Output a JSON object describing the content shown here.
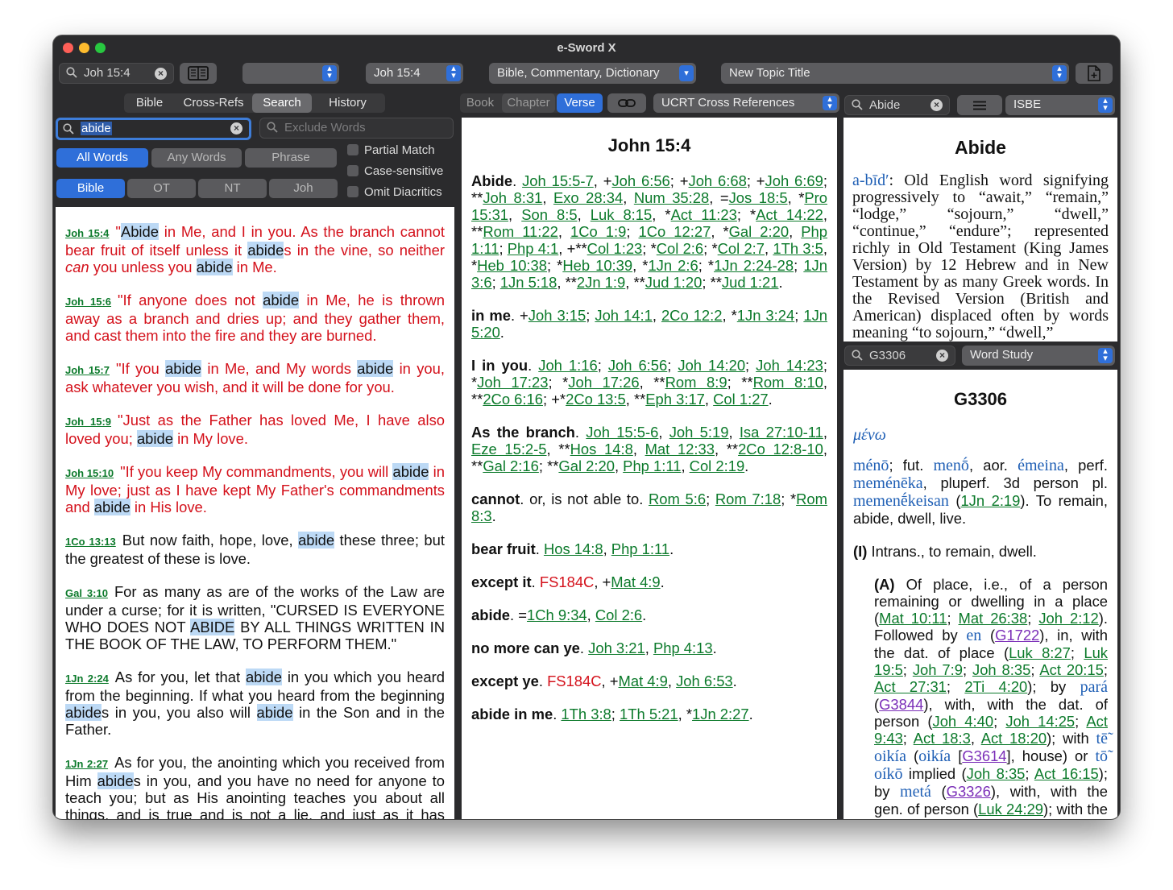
{
  "window": {
    "title": "e-Sword X"
  },
  "toolbar": {
    "nav_search": {
      "value": "Joh 15:4"
    },
    "verse_popup": "Joh 15:4",
    "layout_popup": "Bible, Commentary, Dictionary",
    "topic_popup": "New Topic Title"
  },
  "left": {
    "tabs": [
      "Bible",
      "Cross-Refs",
      "Search",
      "History"
    ],
    "search": {
      "value": "abide",
      "exclude_placeholder": "Exclude Words"
    },
    "modes": [
      "All Words",
      "Any Words",
      "Phrase"
    ],
    "scopes": [
      "Bible",
      "OT",
      "NT",
      "Joh"
    ],
    "options": [
      "Partial Match",
      "Case-sensitive",
      "Omit Diacritics"
    ]
  },
  "results": [
    {
      "ref": "Joh 15:4"
    },
    {
      "ref": "Joh 15:6"
    },
    {
      "ref": "Joh 15:7"
    },
    {
      "ref": "Joh 15:9"
    },
    {
      "ref": "Joh 15:10"
    },
    {
      "ref": "1Co 13:13"
    },
    {
      "ref": "Gal 3:10"
    },
    {
      "ref": "1Jn 2:24"
    },
    {
      "ref": "1Jn 2:27"
    }
  ],
  "middle": {
    "tabs": [
      "Book",
      "Chapter",
      "Verse"
    ],
    "module": "UCRT Cross References",
    "heading": "John 15:4"
  },
  "right_top": {
    "search": "Abide",
    "module": "ISBE",
    "heading": "Abide"
  },
  "right_bottom": {
    "search": "G3306",
    "module": "Word Study",
    "heading": "G3306"
  }
}
